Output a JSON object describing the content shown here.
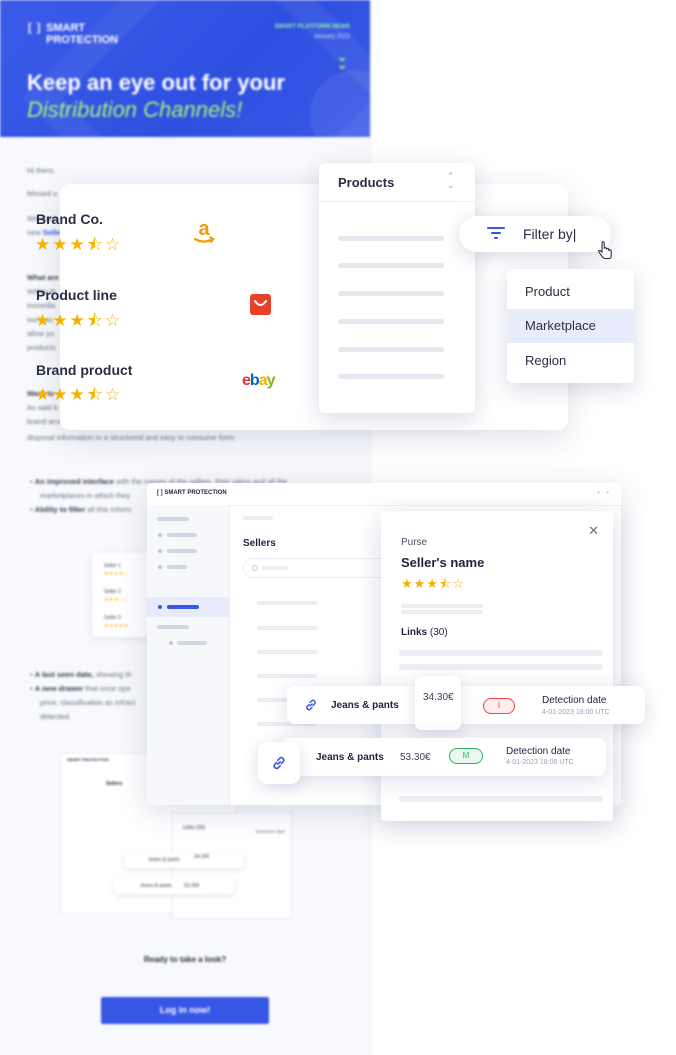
{
  "newsletter": {
    "brand": [
      "SMART",
      "PROTECTION"
    ],
    "brand_bracket": "[ ]",
    "news_label": "SMART PLATFORM NEWS",
    "news_date": "January 2023",
    "title_line1": "Keep an eye out for your",
    "title_line2": "Distribution Channels!",
    "greeting": "Hi there,",
    "p1": "Missed u",
    "p2": "We woul",
    "p2b": "new",
    "p2_link": "Selle",
    "section1": "What are",
    "s1_lines": [
      "Within th",
      "immedia",
      "such as",
      "allow yo",
      "products"
    ],
    "section2": "Want to",
    "s2_lines": [
      "As said b",
      "brand ans",
      "disposal information in a structured and easy to consume form:"
    ],
    "bullet1_bold": "An improved interface",
    "bullet1_rest": " with the names of the sellers, their rating and all the",
    "bullet1_line2": "marketplaces in which they",
    "bullet2_bold": "Ability to filter",
    "bullet2_rest": " all this inform",
    "mini_sellers": [
      "Seller 1",
      "Seller 2",
      "Seller 3"
    ],
    "bullet3_bold": "A last seen date,",
    "bullet3_rest": " showing th",
    "bullet4_bold": "A new drawer",
    "bullet4_rest": " that once ope",
    "bullet4_line2": "price, classification as infract",
    "bullet4_line3": "detected.",
    "mini_logo": "SMART PROTECTION",
    "mini_sellers_title": "Sellers",
    "mini_links": "Links (30)",
    "mini_detect": "Detection date",
    "mini_jeans": "Jeans & pants",
    "mini_price": "34.30€",
    "mini_price2": "53.30€",
    "ready": "Ready to take a look?",
    "login": "Log in now!"
  },
  "brand_card": {
    "rows": [
      {
        "name": "Brand Co.",
        "rating": 3.5,
        "marketplace": "amazon"
      },
      {
        "name": "Product line",
        "rating": 3.5,
        "marketplace": "aliexpress"
      },
      {
        "name": "Brand product",
        "rating": 3.5,
        "marketplace": "ebay"
      }
    ],
    "stars_text": "★★★⯪☆",
    "ebay": [
      "e",
      "b",
      "a",
      "y"
    ]
  },
  "products_dropdown": {
    "title": "Products",
    "icon": "sort-icon"
  },
  "filter": {
    "label": "Filter by",
    "icon": "filter-icon",
    "options": [
      "Product",
      "Marketplace",
      "Region"
    ],
    "selected": "Marketplace"
  },
  "app": {
    "logo": "[ ] SMART  PROTECTION",
    "sellers_title": "Sellers",
    "drawer": {
      "category": "Purse",
      "seller_name": "Seller's name",
      "stars_text": "★★★⯪☆",
      "links_label": "Links",
      "links_count": "(30)"
    },
    "chips": [
      {
        "product": "Jeans & pants",
        "price": "34.30€",
        "badge": "I",
        "badge_color": "#e5484d",
        "detect_label": "Detection date",
        "detect_value": "4-01-2023 18:00 UTC"
      },
      {
        "product": "Jeans & pants",
        "price": "53.30€",
        "badge": "M",
        "badge_color": "#2fb561",
        "detect_label": "Detection date",
        "detect_value": "4-01-2023 18:00 UTC"
      }
    ]
  },
  "colors": {
    "primary": "#3656e6",
    "star": "#f5b300",
    "accent_green": "#a9f07d"
  }
}
